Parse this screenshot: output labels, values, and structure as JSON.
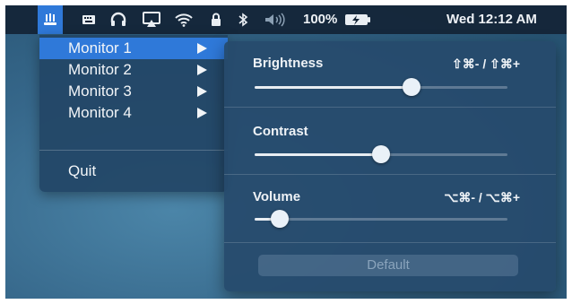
{
  "menubar": {
    "icons": [
      "display-menu-icon",
      "keyboard-icon",
      "headphones-icon",
      "airplay-icon",
      "wifi-icon",
      "lock-icon",
      "bluetooth-icon",
      "volume-icon"
    ],
    "battery_percent": "100%",
    "clock": "Wed 12:12 AM"
  },
  "menu": {
    "items": [
      {
        "label": "Monitor 1",
        "selected": true
      },
      {
        "label": "Monitor 2",
        "selected": false
      },
      {
        "label": "Monitor 3",
        "selected": false
      },
      {
        "label": "Monitor 4",
        "selected": false
      }
    ],
    "quit_label": "Quit"
  },
  "panel": {
    "brightness": {
      "label": "Brightness",
      "shortcut": "⇧⌘- / ⇧⌘+",
      "value": 0.62
    },
    "contrast": {
      "label": "Contrast",
      "shortcut": "",
      "value": 0.5
    },
    "volume": {
      "label": "Volume",
      "shortcut": "⌥⌘- / ⌥⌘+",
      "value": 0.1
    },
    "default_label": "Default"
  },
  "colors": {
    "accent": "#2f79d9",
    "menubar": "#142436",
    "panel": "#264a6c"
  }
}
